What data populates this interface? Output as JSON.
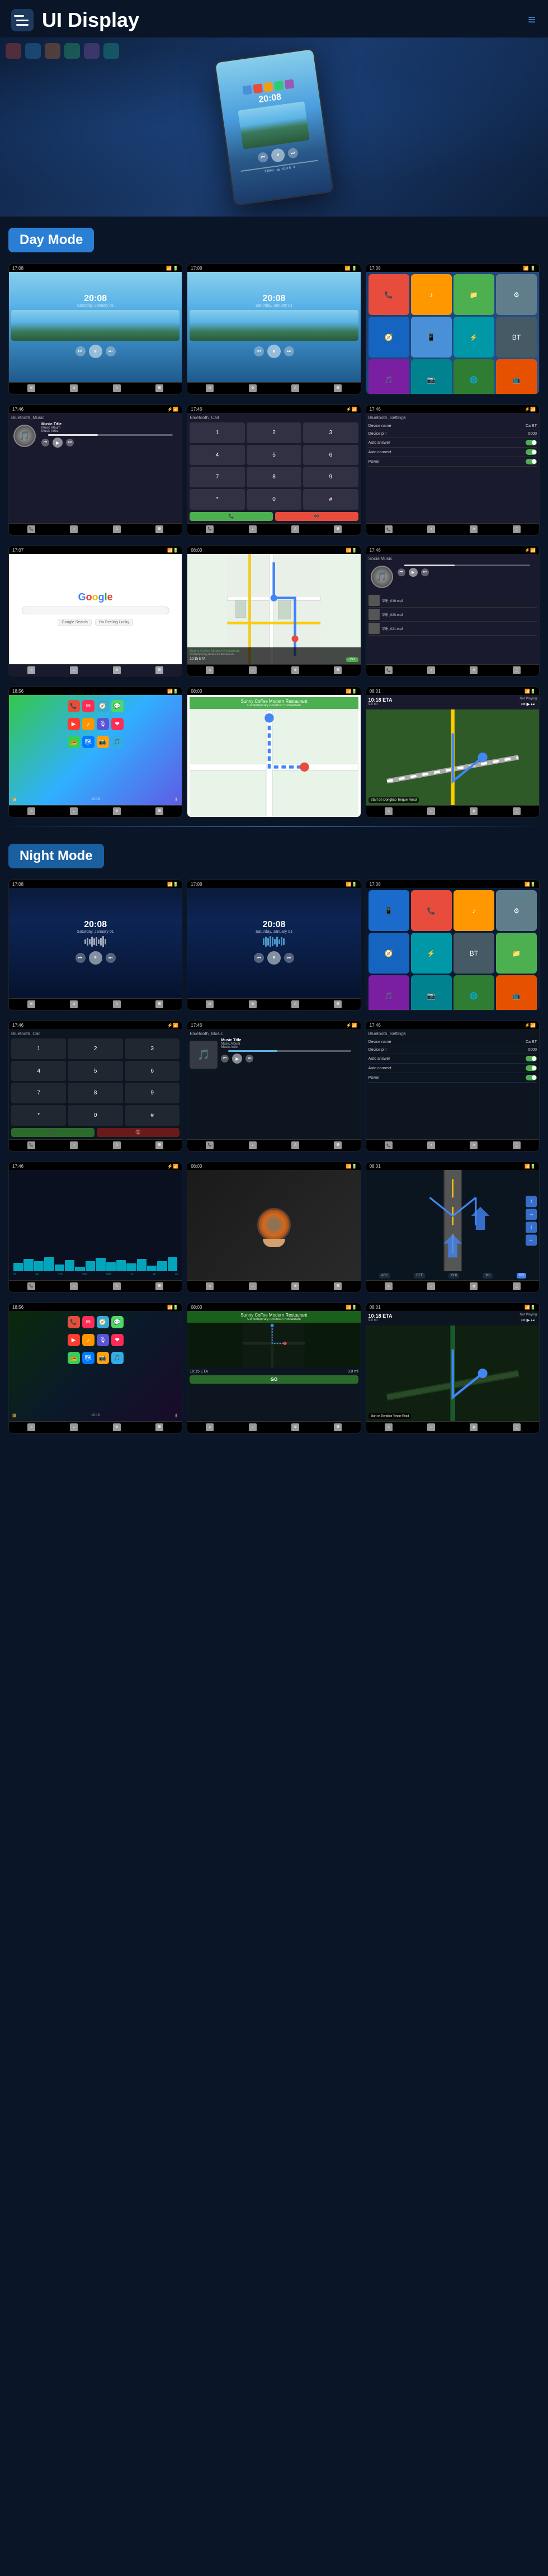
{
  "header": {
    "title": "UI Display",
    "menu_label": "≡",
    "hamburger_label": "≡"
  },
  "day_mode": {
    "label": "Day Mode"
  },
  "night_mode": {
    "label": "Night Mode"
  },
  "screens": {
    "time": "20:08",
    "time_sub": "Saturday, January 01",
    "music_title": "Music Title",
    "music_album": "Music Album",
    "music_artist": "Music Artist",
    "bluetooth_music": "Bluetooth_Music",
    "bluetooth_call": "Bluetooth_Call",
    "bluetooth_settings": "Bluetooth_Settings",
    "device_name": "Device name",
    "device_pin": "Device pin",
    "auto_answer": "Auto answer",
    "auto_connect": "Auto connect",
    "power": "Power",
    "device_name_val": "CarBT",
    "device_pin_val": "0000",
    "google_text": "Google",
    "restaurant_name": "Sunny Coffee Modern Restaurant",
    "restaurant_sub": "Contemporary American Restaurant",
    "nav_eta": "10:15 ETA",
    "nav_dist": "9.0 mi",
    "nav_go": "GO",
    "nav_start": "Start on Dongliao Torque Road",
    "not_playing": "Not Playing",
    "social_music": "SocialMusic",
    "local_music_files": [
      "华乐_019.mp3",
      "华乐_020.mp3",
      "华乐_021.mp3"
    ]
  },
  "icons": {
    "menu": "☰",
    "play": "▶",
    "pause": "⏸",
    "prev": "⏮",
    "next": "⏭",
    "phone": "📞",
    "music": "♪",
    "map": "🗺",
    "settings": "⚙",
    "home": "⌂",
    "back": "←",
    "search": "🔍",
    "mic": "🎤",
    "bluetooth": "⚡",
    "wifi": "📶",
    "volume": "🔊"
  },
  "colors": {
    "accent": "#2a7fd4",
    "bg_dark": "#0a1628",
    "day_sky": "#87ceeb",
    "night_sky": "#0a1628",
    "green_btn": "#4CAF50",
    "red_btn": "#e74c3c"
  }
}
